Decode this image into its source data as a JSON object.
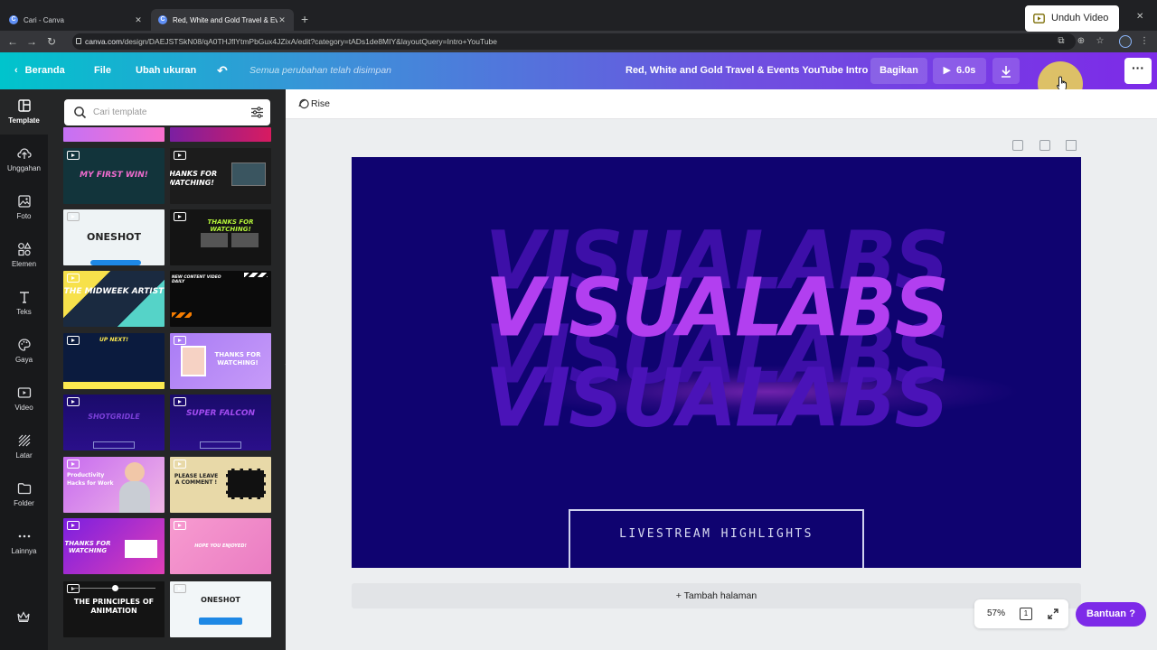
{
  "browser": {
    "tabs": [
      {
        "title": "Cari - Canva",
        "close": "✕"
      },
      {
        "title": "Red, White and Gold Travel & Events YouTube Intro",
        "close": "✕"
      }
    ],
    "new_tab": "+",
    "window_controls": {
      "minimize": "–",
      "maximize": "❐",
      "close": "✕"
    },
    "url_host": "canva.com",
    "url_path": "/design/DAEJSTSkN08/qA0THJflYtmPbGux4JZixA/edit?category=tADs1de8MIY&layoutQuery=Intro+YouTube"
  },
  "topbar": {
    "back_label": "Beranda",
    "file_label": "File",
    "resize_label": "Ubah ukuran",
    "saved_status": "Semua perubahan telah disimpan",
    "doc_title": "Red, White and Gold Travel & Events YouTube Intro",
    "share_label": "Bagikan",
    "play_duration": "6.0s",
    "download_video_label": "Unduh Video",
    "more_label": "···"
  },
  "rail": {
    "items": [
      {
        "label": "Template",
        "icon": "template-icon"
      },
      {
        "label": "Unggahan",
        "icon": "upload-icon"
      },
      {
        "label": "Foto",
        "icon": "photo-icon"
      },
      {
        "label": "Elemen",
        "icon": "elements-icon"
      },
      {
        "label": "Teks",
        "icon": "text-icon"
      },
      {
        "label": "Gaya",
        "icon": "palette-icon"
      },
      {
        "label": "Video",
        "icon": "video-icon"
      },
      {
        "label": "Latar",
        "icon": "background-icon"
      },
      {
        "label": "Folder",
        "icon": "folder-icon"
      },
      {
        "label": "Lainnya",
        "icon": "more-icon"
      }
    ]
  },
  "panel": {
    "search_placeholder": "Cari template",
    "templates": [
      {
        "text": "MY FIRST WIN!"
      },
      {
        "text": "THANKS FOR WATCHING!"
      },
      {
        "text": "ONESHOT"
      },
      {
        "text": "THANKS FOR WATCHING!"
      },
      {
        "text": "THE MIDWEEK ARTIST"
      },
      {
        "text": "NEW CONTENT VIDEO DAILY"
      },
      {
        "text": "UP NEXT!"
      },
      {
        "text": "THANKS FOR WATCHING!"
      },
      {
        "text": "SHOTGRIDLE"
      },
      {
        "text": "SUPER FALCON"
      },
      {
        "text": "Productivity Hacks for Work"
      },
      {
        "text": "PLEASE LEAVE A COMMENT !"
      },
      {
        "text": "THANKS FOR WATCHING"
      },
      {
        "text": "HOPE YOU ENJOYED!"
      },
      {
        "text": "THE PRINCIPLES OF ANIMATION"
      },
      {
        "text": "ONESHOT"
      }
    ]
  },
  "editor": {
    "animation_label": "Rise",
    "canvas": {
      "main_text": "VISUALABS",
      "echo_text": "VISUALABS",
      "subtitle": "LIVESTREAM HIGHLIGHTS",
      "background_color": "#0f0370",
      "text_color": "#b23ff0"
    },
    "add_page_label": "+ Tambah halaman",
    "zoom": "57%",
    "page_number": "1",
    "help_label": "Bantuan",
    "help_icon": "?"
  }
}
